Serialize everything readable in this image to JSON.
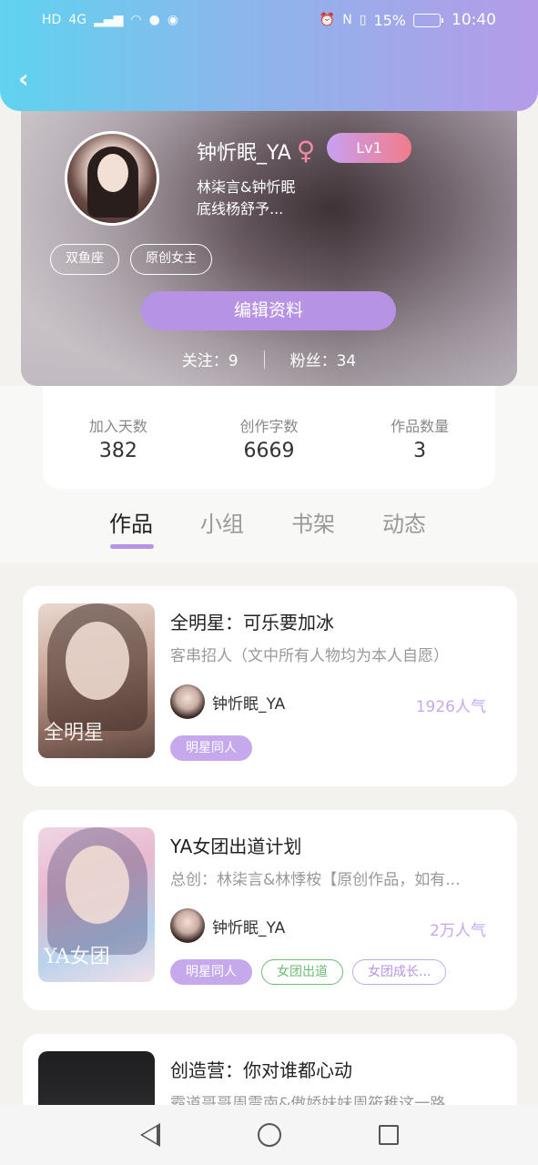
{
  "status_bar": {
    "left_icons": [
      "HD",
      "4G",
      "signal-icon",
      "wifi-icon",
      "wechat-icon",
      "browser-icon"
    ],
    "right_icons": [
      "alarm-icon",
      "nfc-icon",
      "vibrate-icon"
    ],
    "battery": "15%",
    "time": "10:40"
  },
  "profile": {
    "username": "钟忻眠_YA",
    "gender_symbol": "♀",
    "level": "Lv1",
    "bio_line1": "林柒言&钟忻眠",
    "bio_line2": "底线杨舒予...",
    "tags": [
      "双鱼座",
      "原创女主"
    ],
    "edit_button": "编辑资料",
    "following_label": "关注：9",
    "followers_label": "粉丝：34"
  },
  "stats": [
    {
      "label": "加入天数",
      "value": "382"
    },
    {
      "label": "创作字数",
      "value": "6669"
    },
    {
      "label": "作品数量",
      "value": "3"
    }
  ],
  "tabs": [
    "作品",
    "小组",
    "书架",
    "动态"
  ],
  "works": [
    {
      "title": "全明星：可乐要加冰",
      "desc": "客串招人（文中所有人物均为本人自愿）",
      "author": "钟忻眠_YA",
      "popularity": "1926人气",
      "chips": [
        "明星同人"
      ],
      "cover_text": "全明星"
    },
    {
      "title": "YA女团出道计划",
      "desc": "总创：林柒言&林悸桉【原创作品，如有...",
      "author": "钟忻眠_YA",
      "popularity": "2万人气",
      "chips": [
        "明星同人",
        "女团出道",
        "女团成长..."
      ],
      "cover_text": "YA女团"
    },
    {
      "title": "创造营：你对谁都心动",
      "desc": "霸道哥哥周震南&傲娇妹妹周筱稚这一路"
    }
  ],
  "colors": {
    "accent_purple": "#b793e6",
    "popularity_purple": "#c6a9ec",
    "chip_green": "#6dbb76"
  }
}
